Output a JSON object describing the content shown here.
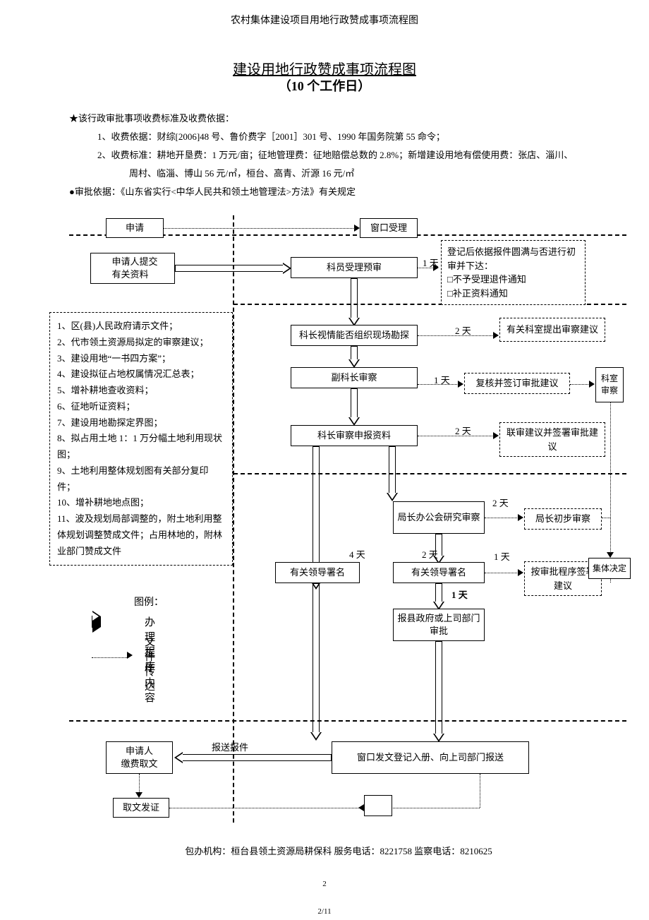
{
  "header_small": "农村集体建设项目用地行政赞成事项流程图",
  "title": "建设用地行政赞成事项流程图",
  "subtitle_prefix": "（",
  "subtitle_days": "10",
  "subtitle_suffix": " 个工作日）",
  "intro": {
    "line0": "★该行政审批事项收费标准及收费依据：",
    "line1": "1、收费依据：财综[2006]48 号、鲁价费字［2001］301 号、1990 年国务院第 55 命令；",
    "line2": "2、收费标准：耕地开垦费：1 万元/亩；征地管理费：征地赔偿总数的 2.8%；新增建设用地有偿使用费：张店、淄川、",
    "line2b": "周村、临淄、博山 56 元/㎡，桓台、高青、沂源 16 元/㎡",
    "line3": "●审批依据：《山东省实行<中华人民共和领土地管理法>方法》有关规定"
  },
  "nodes": {
    "apply": "申请",
    "window_accept": "窗口受理",
    "applicant_submit": "申请人提交\n有关资料",
    "clerk_preexam": "科员受理预审",
    "registration": "登记后依据报件圆满与否进行初审并下达：\n□不予受理退件通知\n□补正资料通知",
    "section_chief_survey": "科长视情能否组织现场勘探",
    "relevant_office_suggest": "有关科室提出审察建议",
    "deputy_review": "副科长审察",
    "recheck_sign": "复核并签订审批建议",
    "office_review": "科室审察",
    "section_chief_materials": "科长审察申报资料",
    "joint_review_sign": "联审建议并签署审批建议",
    "bureau_meeting": "局长办公会研究审察",
    "bureau_prelim": "局长初步审察",
    "leader_sign_left": "有关领导署名",
    "leader_sign_right": "有关领导署名",
    "sign_by_procedure": "按审批程序签署建议",
    "collective_decision": "集体决定",
    "report_county": "报县政府或上司部门审批",
    "window_issue": "窗口发文登记入册、向上司部门报送",
    "applicant_pay": "申请人\n缴费取文",
    "get_cert": "取文发证",
    "send_report": "报送报件"
  },
  "durations": {
    "d1a": "1 天",
    "d2a": "2 天",
    "d1b": "1 天",
    "d2b": "2 天",
    "d2c": "2 天",
    "d4": "4 天",
    "d2d": "2 天",
    "d1c": "1 天",
    "d1d": "1 天"
  },
  "doclist": {
    "items": [
      "1、区(县)人民政府请示文件；",
      "2、代市领土资源局拟定的审察建议；",
      "3、建设用地“一书四方案”；",
      "4、建设拟征占地权属情况汇总表；",
      "5、增补耕地查收资料；",
      "6、征地听证资料；",
      "7、建设用地勘探定界图；",
      "8、拟占用土地 1：1 万分幅土地利用现状图；",
      "9、土地利用整体规划图有关部分复印件；",
      "10、增补耕地地点图；",
      "11、波及规划局部调整的，附土地利用整体规划调整赞成文件；占用林地的，附林业部门赞成文件"
    ]
  },
  "legend": {
    "title": "图例：",
    "process": "办理程序",
    "file": "文件传达",
    "work": "工作内容"
  },
  "footer": "包办机构：桓台县领土资源局耕保科 服务电话：8221758 监察电话：8210625",
  "pagenum": "2",
  "pagefoot": "2/11"
}
